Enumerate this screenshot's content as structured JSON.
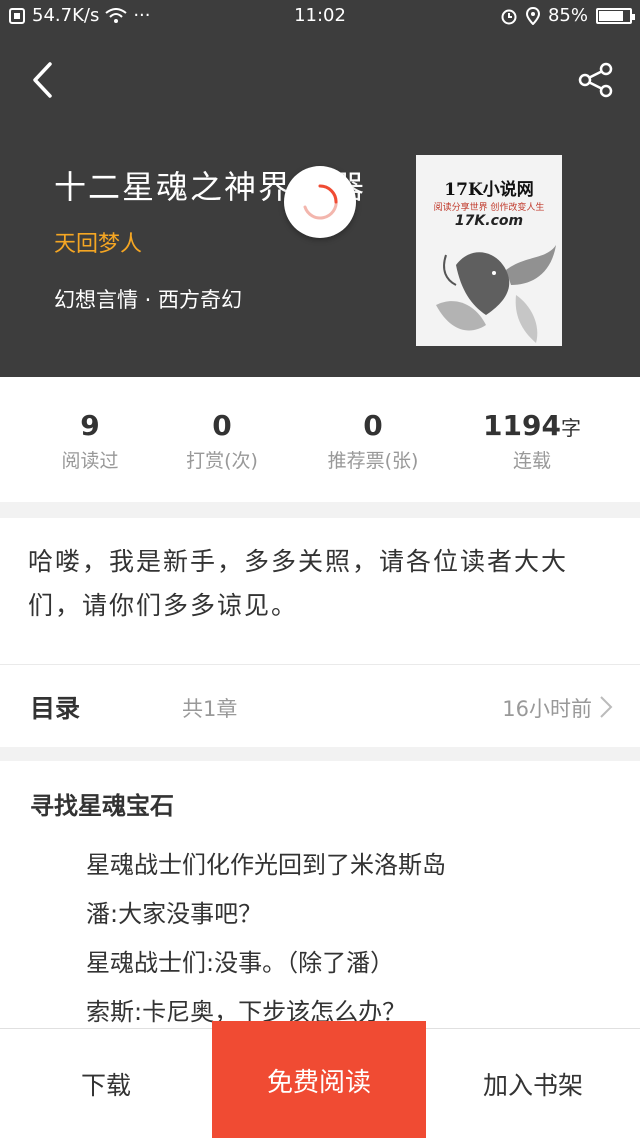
{
  "status_bar": {
    "speed": "54.7K/s",
    "more": "···",
    "time": "11:02",
    "battery": "85%",
    "battery_level": 0.85
  },
  "header": {
    "book_title": "十二星魂之神界",
    "title_tail": "器",
    "author": "天回梦人",
    "genre": "幻想言情 · 西方奇幻",
    "cover": {
      "title": "17K小说网",
      "slogan": "阅读分享世界  创作改变人生",
      "logo": "17K.com"
    }
  },
  "stats": [
    {
      "value": "9",
      "unit": "",
      "label": "阅读过"
    },
    {
      "value": "0",
      "unit": "",
      "label": "打赏(次)"
    },
    {
      "value": "0",
      "unit": "",
      "label": "推荐票(张)"
    },
    {
      "value": "1194",
      "unit": "字",
      "label": "连载"
    }
  ],
  "intro": "哈喽，我是新手，多多关照，请各位读者大大们，请你们多多谅见。",
  "catalog": {
    "label": "目录",
    "count": "共1章",
    "updated": "16小时前"
  },
  "chapter": {
    "title": "寻找星魂宝石",
    "lines": [
      "星魂战士们化作光回到了米洛斯岛",
      "潘:大家没事吧？",
      "星魂战士们:没事。（除了潘）",
      "索斯:卡尼奥，下步该怎么办？"
    ]
  },
  "bottom_bar": {
    "download": "下载",
    "free_read": "免费阅读",
    "add_shelf": "加入书架"
  }
}
